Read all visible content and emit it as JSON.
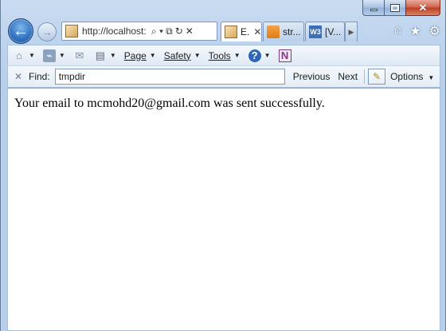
{
  "window": {
    "caption_buttons": [
      "minimize",
      "maximize",
      "close"
    ]
  },
  "nav": {
    "address_url": "http://localhost:",
    "address_controls": {
      "search": "⌕ ▾",
      "compat": "⧉",
      "refresh": "↻",
      "stop": "✕"
    }
  },
  "tabs": [
    {
      "label": "E.",
      "icon": "image-favicon",
      "active": true,
      "closable": true
    },
    {
      "label": "str...",
      "icon": "stackoverflow-favicon",
      "active": false,
      "closable": false
    },
    {
      "label": "[V...",
      "icon": "w3-favicon",
      "active": false,
      "closable": false
    }
  ],
  "tab_favicon_text": {
    "w3": "W3"
  },
  "toolbar_icons": [
    "home-icon",
    "star-icon",
    "gear-icon"
  ],
  "command_bar": {
    "page_label": "Page",
    "safety_label": "Safety",
    "tools_label": "Tools",
    "help_icon_text": "?",
    "onenote_icon_text": "N",
    "feed_icon_text": "⌁"
  },
  "find_bar": {
    "label": "Find:",
    "value": "tmpdir",
    "previous_label": "Previous",
    "next_label": "Next",
    "options_label": "Options"
  },
  "content": {
    "message": "Your email to mcmohd20@gmail.com was sent successfully."
  }
}
